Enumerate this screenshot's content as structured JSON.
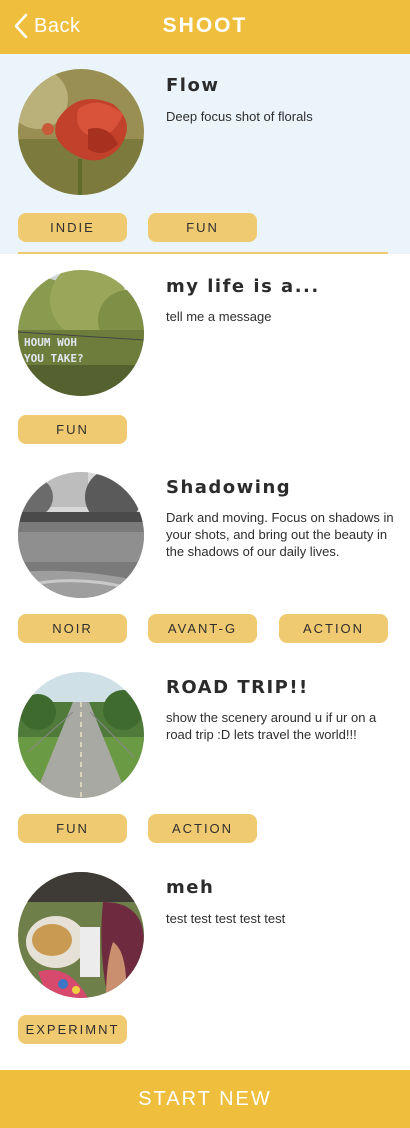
{
  "header": {
    "back_label": "Back",
    "title": "SHOOT"
  },
  "cards": [
    {
      "title": "Flow",
      "description": "Deep focus shot of florals",
      "tags": [
        "INDIE",
        "FUN"
      ]
    },
    {
      "title": "my life is a...",
      "description": "tell me a message",
      "image_text": "HOUM WOH YOU TAKE?",
      "tags": [
        "FUN"
      ]
    },
    {
      "title": "Shadowing",
      "description": "Dark and moving. Focus on shadows in your shots, and bring out the beauty in the shadows of our daily lives.",
      "tags": [
        "NOIR",
        "AVANT-G",
        "ACTION"
      ]
    },
    {
      "title": "ROAD TRIP!!",
      "description": "show the scenery around u if ur on a road trip :D lets travel the world!!!",
      "tags": [
        "FUN",
        "ACTION"
      ]
    },
    {
      "title": "meh",
      "description": "test test test test test",
      "tags": [
        "EXPERIMNT"
      ]
    }
  ],
  "footer": {
    "start_label": "START NEW"
  },
  "colors": {
    "accent": "#efbe3c",
    "tag": "#f0ca71",
    "highlight": "#eaf4fa"
  }
}
